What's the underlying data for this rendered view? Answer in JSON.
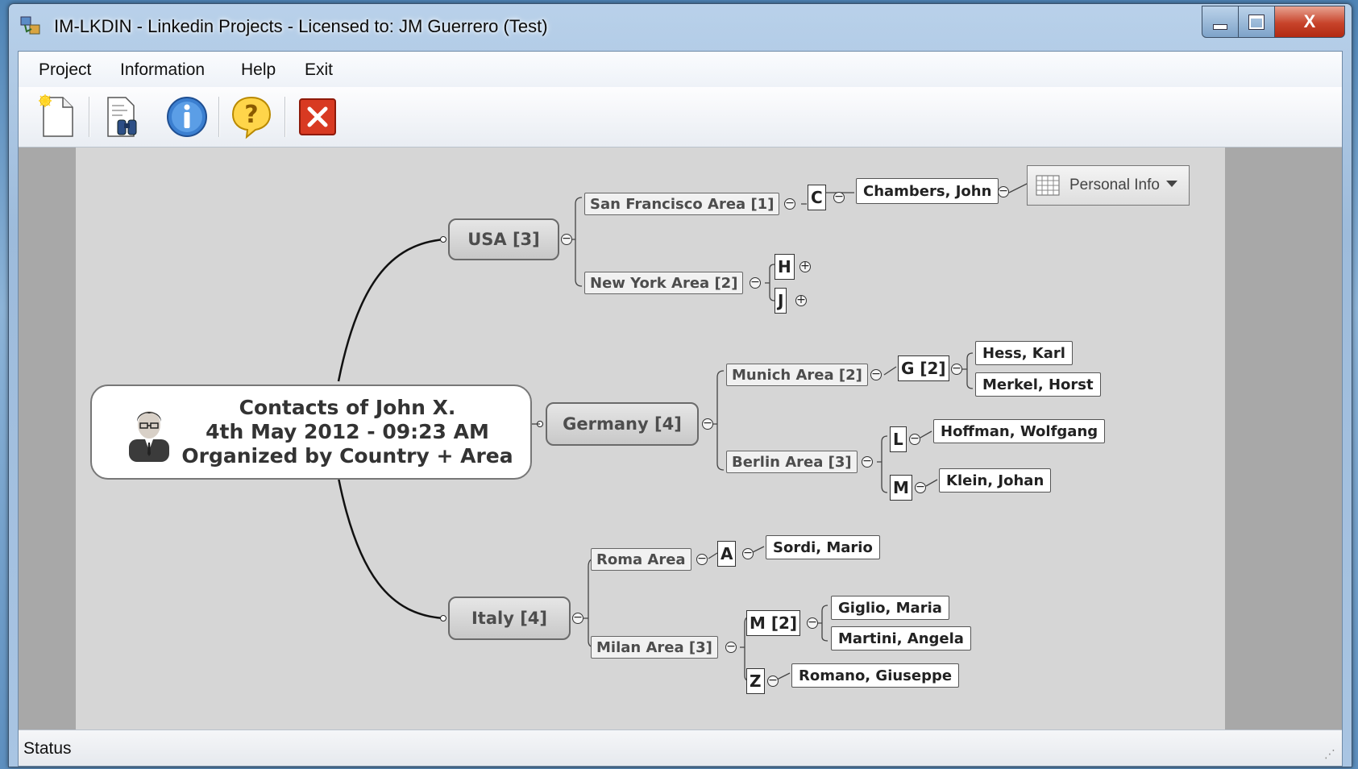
{
  "window": {
    "title": "IM-LKDIN - Linkedin Projects - Licensed to: JM Guerrero (Test)"
  },
  "caption_buttons": {
    "minimize": "minimize-icon",
    "maximize": "maximize-icon",
    "close": "X"
  },
  "menu": {
    "items": [
      "Project",
      "Information",
      "Help",
      "Exit"
    ]
  },
  "toolbar": {
    "icons": [
      "new-document-icon",
      "find-document-icon",
      "info-icon",
      "help-icon",
      "exit-icon"
    ]
  },
  "mindmap": {
    "root": {
      "line1": "Contacts of John X.",
      "line2": "4th May 2012 - 09:23 AM",
      "line3": "Organized by Country + Area"
    },
    "usa": {
      "label": "USA [3]",
      "sf_area": "San Francisco Area [1]",
      "sf_letter": "C",
      "sf_person": "Chambers, John",
      "personal_info": "Personal Info",
      "ny_area": "New York Area [2]",
      "ny_letter_h": "H",
      "ny_letter_j": "J"
    },
    "germany": {
      "label": "Germany [4]",
      "munich_area": "Munich Area [2]",
      "munich_letter": "G [2]",
      "munich_person1": "Hess, Karl",
      "munich_person2": "Merkel, Horst",
      "berlin_area": "Berlin Area [3]",
      "berlin_letter_l": "L",
      "berlin_person_l": "Hoffman, Wolfgang",
      "berlin_letter_m": "M",
      "berlin_person_m": "Klein, Johan"
    },
    "italy": {
      "label": "Italy [4]",
      "roma_area": "Roma Area",
      "roma_letter": "A",
      "roma_person": "Sordi, Mario",
      "milan_area": "Milan Area [3]",
      "milan_letter_m": "M [2]",
      "milan_person1": "Giglio, Maria",
      "milan_person2": "Martini, Angela",
      "milan_letter_z": "Z",
      "milan_person3": "Romano, Giuseppe"
    }
  },
  "status": {
    "text": "Status"
  }
}
